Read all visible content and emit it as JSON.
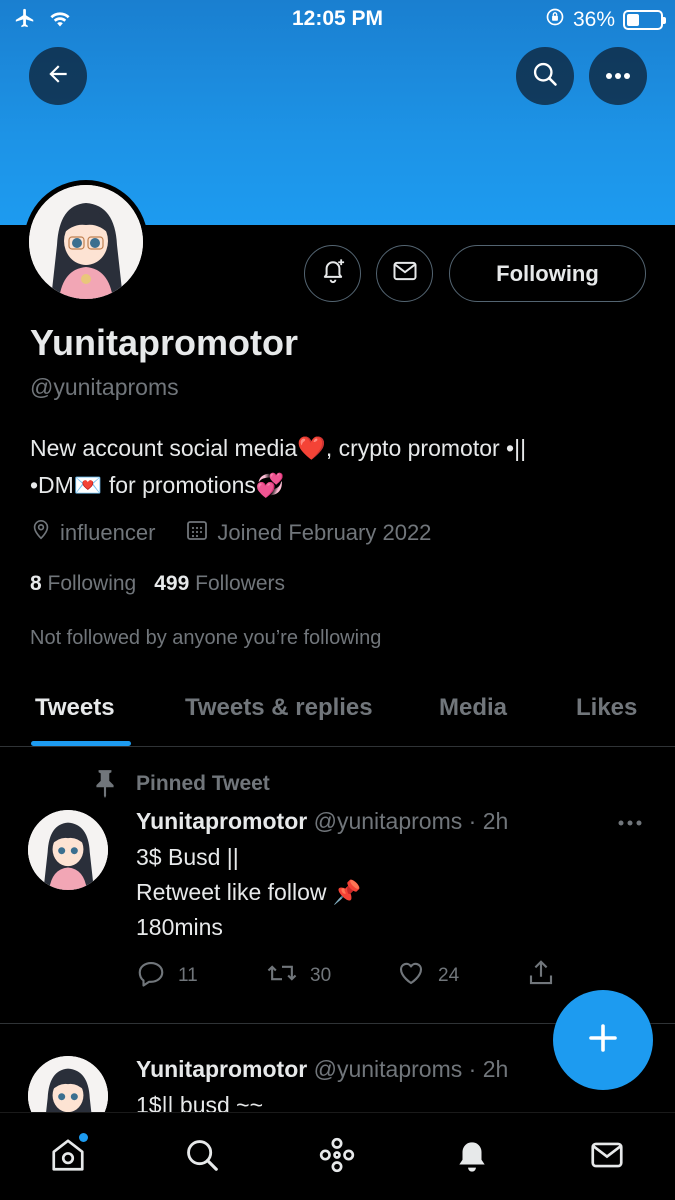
{
  "status_bar": {
    "time": "12:05 PM",
    "battery": "36%",
    "battery_level": 0.36
  },
  "profile": {
    "name": "Yunitapromotor",
    "handle": "@yunitaproms",
    "bio_line1": "New account social media❤️, crypto promotor •||",
    "bio_line2": "•DM💌 for promotions💞",
    "location": "influencer",
    "joined": "Joined February 2022",
    "following_count": "8",
    "following_label": "Following",
    "followers_count": "499",
    "followers_label": "Followers",
    "followed_by_note": "Not followed by anyone you’re following",
    "follow_button_label": "Following"
  },
  "tabs": [
    {
      "label": "Tweets",
      "active": true
    },
    {
      "label": "Tweets & replies"
    },
    {
      "label": "Media"
    },
    {
      "label": "Likes"
    }
  ],
  "tweets": [
    {
      "pinned_label": "Pinned Tweet",
      "name": "Yunitapromotor",
      "handle_time": "@yunitaproms · 2h",
      "line1": "3$ Busd ||",
      "line2": "Retweet like follow 📌",
      "line3": "180mins",
      "replies": "11",
      "retweets": "30",
      "likes": "24"
    },
    {
      "name": "Yunitapromotor",
      "handle_time": "@yunitaproms · 2h",
      "line1": "1$|| busd ~~"
    }
  ],
  "colors": {
    "accent": "#1d9bf0",
    "background": "#000000",
    "muted": "#71767b",
    "text": "#e7e9ea"
  },
  "icons": [
    "back-arrow-icon",
    "search-icon",
    "more-icon",
    "notification-bell-plus-icon",
    "mail-icon",
    "location-pin-icon",
    "calendar-icon",
    "pin-icon",
    "reply-icon",
    "retweet-icon",
    "like-icon",
    "share-icon",
    "compose-plus-icon",
    "home-icon",
    "explore-icon",
    "spaces-icon",
    "notifications-icon",
    "messages-icon"
  ]
}
